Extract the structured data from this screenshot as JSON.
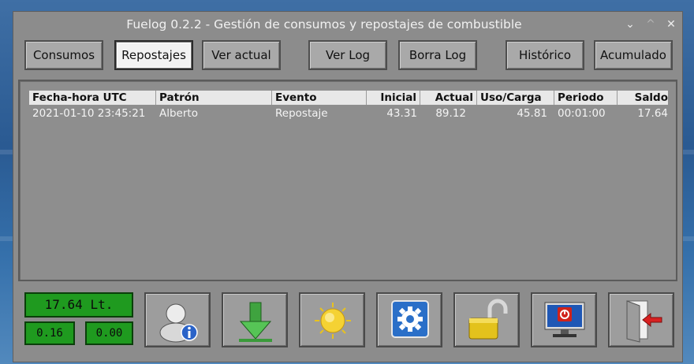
{
  "window": {
    "title": "Fuelog 0.2.2 - Gestión de consumos y repostajes de combustible"
  },
  "titlebar_buttons": {
    "minimize": "⌄",
    "maximize": "^",
    "close": "✕"
  },
  "toolbar": {
    "consumos": "Consumos",
    "repostajes": "Repostajes",
    "ver_actual": "Ver actual",
    "ver_log": "Ver Log",
    "borra_log": "Borra Log",
    "historico": "Histórico",
    "acumulado": "Acumulado"
  },
  "table": {
    "headers": [
      "Fecha-hora UTC",
      "Patrón",
      "Evento",
      "Inicial",
      "Actual",
      "Uso/Carga",
      "Periodo",
      "Saldo"
    ],
    "rows": [
      [
        "2021-01-10 23:45:21",
        "Alberto",
        "Repostaje",
        "43.31",
        "89.12",
        "45.81",
        "00:01:00",
        "17.64"
      ]
    ]
  },
  "status": {
    "fuel_level": "17.64 Lt.",
    "left_value": "0.16",
    "right_value": "0.00"
  },
  "icon_buttons": [
    "user-info-icon",
    "download-arrow-icon",
    "sun-icon",
    "settings-gear-icon",
    "padlock-open-icon",
    "monitor-power-icon",
    "exit-door-icon"
  ],
  "colors": {
    "lcd_green": "#1f9a1f",
    "window_gray": "#8c8c8c",
    "active_button": "#f2f2f2"
  }
}
